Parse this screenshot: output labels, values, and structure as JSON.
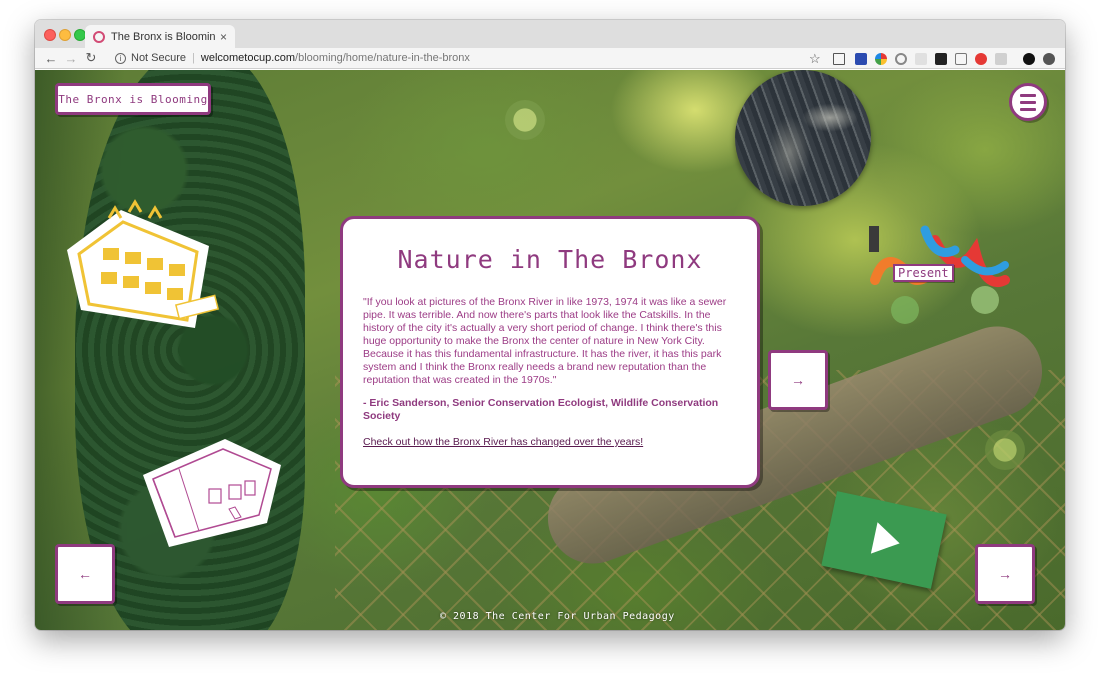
{
  "browser": {
    "tab_title": "The Bronx is Blooming | Nature",
    "tab_close": "×",
    "security_label": "Not Secure",
    "url_host": "welcometocup.com",
    "url_path": "/blooming/home/nature-in-the-bronx"
  },
  "site": {
    "logo_text": "The Bronx is Blooming",
    "present_label": "Present",
    "footer_text": "© 2018 The Center For Urban Pedagogy"
  },
  "card": {
    "title": "Nature in The Bronx",
    "quote": "\"If you look at pictures of the Bronx River in like 1973, 1974 it was like a sewer pipe. It was terrible. And now there's parts that look like the Catskills. In the history of the city it's actually a very short period of change. I think there's this huge opportunity to make the Bronx the center of nature in New York City. Because it has this fundamental infrastructure. It has the river, it has this park system and I think the Bronx really needs a brand new reputation than the reputation that was created in the 1970s.\"",
    "attribution": "- Eric Sanderson, Senior Conservation Ecologist, Wildlife Conservation Society",
    "link_text": "Check out how the Bronx River has changed over the years!"
  },
  "nav": {
    "next_arrow": "→",
    "prev_arrow": "←"
  },
  "colors": {
    "accent": "#8f3a7f"
  }
}
